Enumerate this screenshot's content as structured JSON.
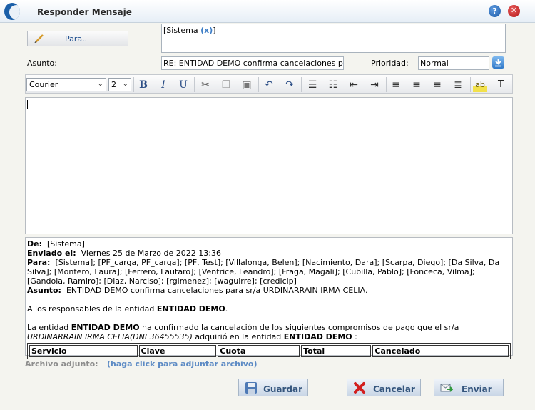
{
  "window": {
    "title": "Responder Mensaje"
  },
  "to": {
    "button_label": "Para..",
    "recipient": "[Sistema ",
    "remove": "(x)",
    "recipient_close": "]"
  },
  "subject": {
    "label": "Asunto:",
    "value": "RE: ENTIDAD DEMO confirma cancelaciones para sr/a URDINARRAIN IRMA CELIA."
  },
  "priority": {
    "label": "Prioridad:",
    "value": "Normal"
  },
  "toolbar": {
    "font": "Courier",
    "size": "2"
  },
  "quoted": {
    "from_label": "De:",
    "from_value": "[Sistema]",
    "sent_label": "Enviado el:",
    "sent_value": "Viernes 25 de Marzo de 2022 13:36",
    "to_label": "Para:",
    "to_value": "[Sistema]; [PF_carga, PF_carga]; [PF, Test]; [Villalonga, Belen]; [Nacimiento, Dara]; [Scarpa, Diego]; [Da Silva, Da Silva]; [Montero, Laura]; [Ferrero, Lautaro]; [Ventrice, Leandro]; [Fraga, Magali]; [Cubilla, Pablo]; [Fonceca, Vilma]; [Gandola, Ramiro]; [Diaz, Narciso]; [rgimenez]; [waguirre]; [credicip]",
    "subject_label": "Asunto:",
    "subject_value": "ENTIDAD DEMO confirma cancelaciones para sr/a URDINARRAIN IRMA CELIA.",
    "greeting_prefix": "A los responsables de la entidad ",
    "greeting_entity": "ENTIDAD DEMO",
    "greeting_suffix": ".",
    "body_a": "La entidad ",
    "body_entity1": "ENTIDAD DEMO",
    "body_b": " ha confirmado la cancelación de los siguientes compromisos de pago que el sr/a ",
    "body_person": "URDINARRAIN IRMA CELIA(DNI 36455535)",
    "body_c": " adquirió en la entidad ",
    "body_entity2": "ENTIDAD DEMO",
    "body_d": " :",
    "table_headers": [
      "Servicio",
      "Clave",
      "Cuota",
      "Total",
      "Cancelado"
    ]
  },
  "attachment": {
    "label": "Archivo adjunto:",
    "link": "(haga click para adjuntar archivo)"
  },
  "buttons": {
    "save": "Guardar",
    "cancel": "Cancelar",
    "send": "Enviar"
  }
}
